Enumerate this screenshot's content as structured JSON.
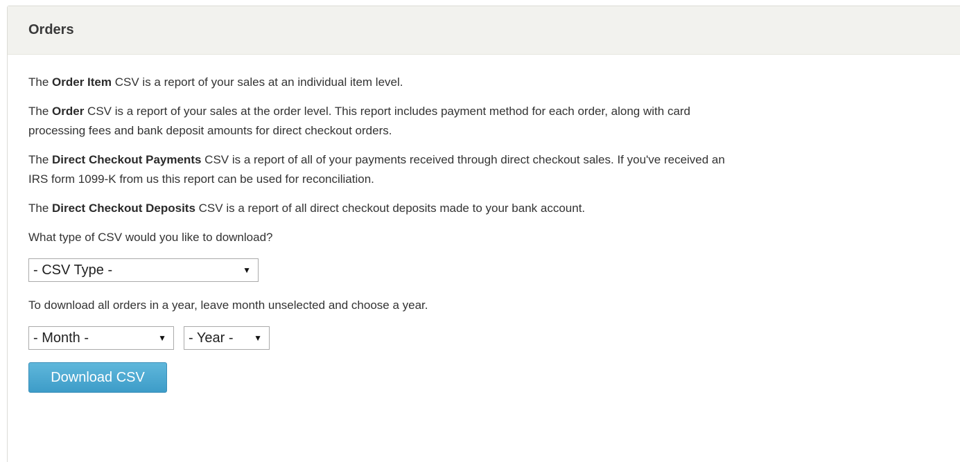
{
  "header": {
    "title": "Orders"
  },
  "descriptions": [
    {
      "prefix": "The ",
      "bold": "Order Item",
      "rest": " CSV is a report of your sales at an individual item level."
    },
    {
      "prefix": "The ",
      "bold": "Order",
      "rest": " CSV is a report of your sales at the order level. This report includes payment method for each order, along with card processing fees and bank deposit amounts for direct checkout orders."
    },
    {
      "prefix": "The ",
      "bold": "Direct Checkout Payments",
      "rest": " CSV is a report of all of your payments received through direct checkout sales. If you've received an IRS form 1099-K from us this report can be used for reconciliation."
    },
    {
      "prefix": "The ",
      "bold": "Direct Checkout Deposits",
      "rest": " CSV is a report of all direct checkout deposits made to your bank account."
    }
  ],
  "question": "What type of CSV would you like to download?",
  "csv_type_select": {
    "selected": "- CSV Type -"
  },
  "hint": "To download all orders in a year, leave month unselected and choose a year.",
  "month_select": {
    "selected": "- Month -"
  },
  "year_select": {
    "selected": "- Year -"
  },
  "download_button": {
    "label": "Download CSV"
  },
  "icons": {
    "dropdown_arrow": "▼"
  },
  "colors": {
    "button": "#4aa8d2",
    "header_bg": "#f2f2ee"
  }
}
